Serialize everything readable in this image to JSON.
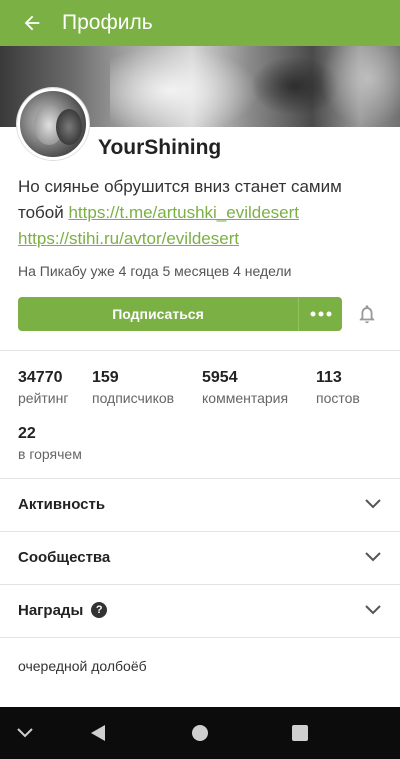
{
  "header": {
    "title": "Профиль",
    "back_icon": "arrow-left-icon"
  },
  "profile": {
    "username": "YourShining",
    "bio_text": "Но сиянье обрушится вниз станет самим тобой ",
    "link1": "https://t.me/artushki_evildesert",
    "link2": "https://stihi.ru/avtor/evildesert",
    "since": "На Пикабу уже 4 года 5 месяцев 4 недели"
  },
  "actions": {
    "subscribe_label": "Подписаться",
    "more_icon": "dots-icon",
    "bell_icon": "bell-icon"
  },
  "stats": [
    {
      "value": "34770",
      "label": "рейтинг"
    },
    {
      "value": "159",
      "label": "подписчиков"
    },
    {
      "value": "5954",
      "label": "комментария"
    },
    {
      "value": "113",
      "label": "постов"
    },
    {
      "value": "22",
      "label": "в горячем"
    }
  ],
  "sections": [
    {
      "title": "Активность"
    },
    {
      "title": "Сообщества"
    },
    {
      "title": "Награды",
      "help": "?"
    }
  ],
  "footer_note": "очередной долбоёб",
  "colors": {
    "accent": "#7bb044",
    "navbar": "#0c0c0c"
  }
}
